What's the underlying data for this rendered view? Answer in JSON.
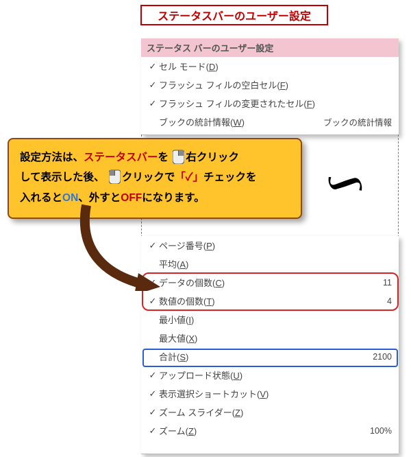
{
  "title": "ステータスバーのユーザー設定",
  "menu": {
    "header": "ステータス バーのユーザー設定",
    "top_items": [
      {
        "checked": true,
        "label_pre": "セル モード(",
        "key": "D",
        "label_post": ")",
        "rhs": ""
      },
      {
        "checked": true,
        "label_pre": "フラッシュ フィルの空白セル(",
        "key": "F",
        "label_post": ")",
        "rhs": ""
      },
      {
        "checked": true,
        "label_pre": "フラッシュ フィルの変更されたセル(",
        "key": "F",
        "label_post": ")",
        "rhs": ""
      },
      {
        "checked": false,
        "label_pre": "ブックの統計情報(",
        "key": "W",
        "label_post": ")",
        "rhs": "ブックの統計情報"
      }
    ],
    "bot_items": [
      {
        "checked": true,
        "label_pre": "ページ番号(",
        "key": "P",
        "label_post": ")",
        "rhs": ""
      },
      {
        "checked": false,
        "label_pre": "平均(",
        "key": "A",
        "label_post": ")",
        "rhs": ""
      },
      {
        "checked": true,
        "label_pre": "データの個数(",
        "key": "C",
        "label_post": ")",
        "rhs": "11"
      },
      {
        "checked": true,
        "label_pre": "数値の個数(",
        "key": "T",
        "label_post": ")",
        "rhs": "4"
      },
      {
        "checked": false,
        "label_pre": "最小値(",
        "key": "I",
        "label_post": ")",
        "rhs": ""
      },
      {
        "checked": false,
        "label_pre": "最大値(",
        "key": "X",
        "label_post": ")",
        "rhs": ""
      },
      {
        "checked": false,
        "label_pre": "合計(",
        "key": "S",
        "label_post": ")",
        "rhs": "2100"
      },
      {
        "checked": true,
        "label_pre": "アップロード状態(",
        "key": "U",
        "label_post": ")",
        "rhs": ""
      },
      {
        "checked": true,
        "label_pre": "表示選択ショートカット(",
        "key": "V",
        "label_post": ")",
        "rhs": ""
      },
      {
        "checked": true,
        "label_pre": "ズーム スライダー(",
        "key": "Z",
        "label_post": ")",
        "rhs": ""
      },
      {
        "checked": true,
        "label_pre": "ズーム(",
        "key": "Z",
        "label_post": ")",
        "rhs": "100%"
      }
    ]
  },
  "callout": {
    "t1": "設定方法は、",
    "t2": "ステータスバー",
    "t3": "を",
    "t4": "右クリック",
    "t5": "して表示した後、",
    "t6": "クリックで",
    "t7": "「✓」",
    "t8": "チェックを",
    "t9": "入れると",
    "t10": "ON",
    "t11": "、外すと",
    "t12": "OFF",
    "t13": "になります。"
  },
  "icons": {
    "check": "✓",
    "tilde": "∫"
  }
}
